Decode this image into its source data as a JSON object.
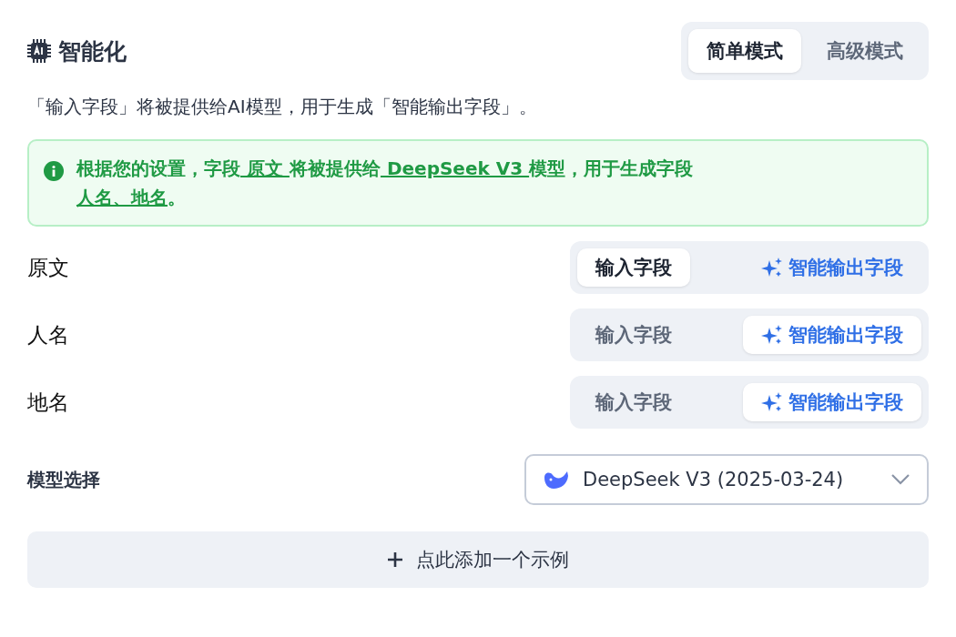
{
  "header": {
    "title": "智能化",
    "modes": [
      {
        "label": "简单模式",
        "selected": true
      },
      {
        "label": "高级模式",
        "selected": false
      }
    ]
  },
  "description": "「输入字段」将被提供给AI模型，用于生成「智能输出字段」。",
  "alert": {
    "segments": [
      {
        "text": "根据您的设置，字段",
        "kind": "text"
      },
      {
        "text": " 原文 ",
        "kind": "link"
      },
      {
        "text": "将被提供给",
        "kind": "text"
      },
      {
        "text": " DeepSeek V3 ",
        "kind": "link"
      },
      {
        "text": "模型，用于生成字段",
        "kind": "text"
      },
      {
        "text": " 人名、地名",
        "kind": "link"
      },
      {
        "text": "。",
        "kind": "text"
      }
    ]
  },
  "fields": [
    {
      "name": "原文",
      "options": [
        {
          "label": "输入字段",
          "kind": "input",
          "selected": true
        },
        {
          "label": "智能输出字段",
          "kind": "output",
          "selected": false
        }
      ]
    },
    {
      "name": "人名",
      "options": [
        {
          "label": "输入字段",
          "kind": "input",
          "selected": false
        },
        {
          "label": "智能输出字段",
          "kind": "output",
          "selected": true
        }
      ]
    },
    {
      "name": "地名",
      "options": [
        {
          "label": "输入字段",
          "kind": "input",
          "selected": false
        },
        {
          "label": "智能输出字段",
          "kind": "output",
          "selected": true
        }
      ]
    }
  ],
  "model": {
    "label": "模型选择",
    "value": "DeepSeek V3 (2025-03-24)"
  },
  "add_button": {
    "label": "点此添加一个示例"
  }
}
